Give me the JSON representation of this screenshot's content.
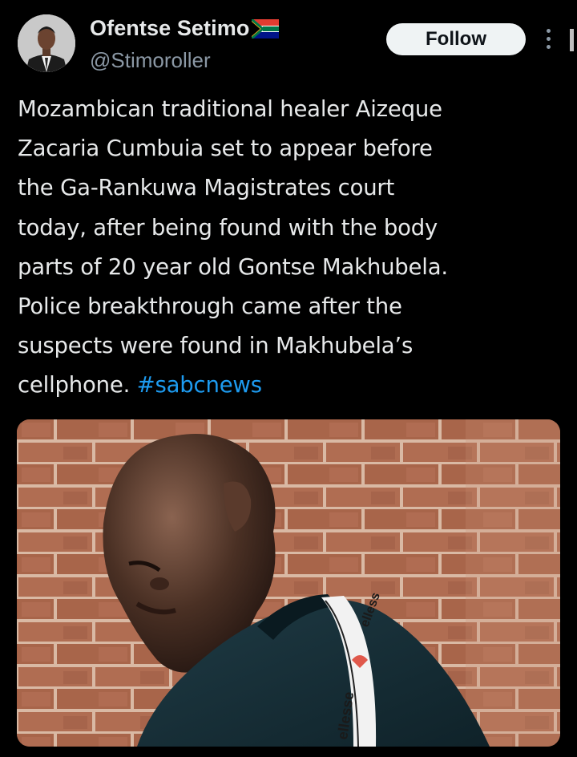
{
  "author": {
    "display_name": "Ofentse Setimo",
    "handle": "@Stimoroller",
    "flag_icon": "south-africa-flag-icon"
  },
  "actions": {
    "follow_label": "Follow",
    "more_icon": "more-vertical-icon"
  },
  "tweet": {
    "text": "Mozambican traditional healer Aizeque\nZacaria Cumbuia set to appear before\nthe Ga-Rankuwa Magistrates court\ntoday, after being found with the body\nparts of 20 year old Gontse Makhubela.\nPolice breakthrough came after the\nsuspects were found in Makhubela’s\ncellphone. ",
    "hashtag": "#sabcnews"
  },
  "media": {
    "jacket_brand_1": "ellesse",
    "jacket_brand_2": "elless"
  },
  "colors": {
    "background": "#000000",
    "text": "#e7e9ea",
    "secondary": "#8b98a5",
    "link": "#1d9bf0",
    "button_bg": "#eff3f4"
  }
}
